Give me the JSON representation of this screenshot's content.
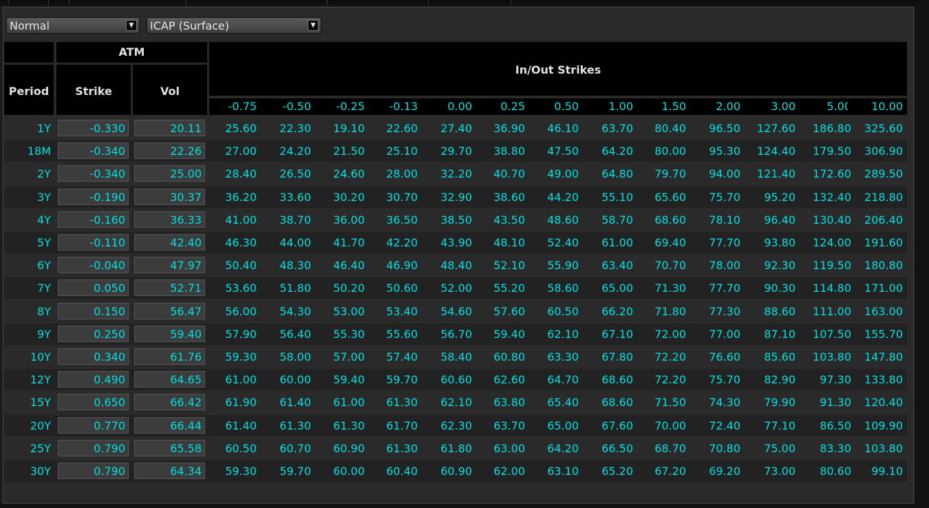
{
  "controls": {
    "mode": "Normal",
    "source": "ICAP (Surface)"
  },
  "headers": {
    "atm": "ATM",
    "period": "Period",
    "strike": "Strike",
    "vol": "Vol",
    "in_out": "In/Out Strikes"
  },
  "strike_columns": [
    "-0.75",
    "-0.50",
    "-0.25",
    "-0.13",
    "0.00",
    "0.25",
    "0.50",
    "1.00",
    "1.50",
    "2.00",
    "3.00",
    "5.00",
    "10.00"
  ],
  "rows": [
    {
      "period": "1Y",
      "strike": "-0.330",
      "vol": "20.11",
      "values": [
        "25.60",
        "22.30",
        "19.10",
        "22.60",
        "27.40",
        "36.90",
        "46.10",
        "63.70",
        "80.40",
        "96.50",
        "127.60",
        "186.80",
        "325.60"
      ]
    },
    {
      "period": "18M",
      "strike": "-0.340",
      "vol": "22.26",
      "values": [
        "27.00",
        "24.20",
        "21.50",
        "25.10",
        "29.70",
        "38.80",
        "47.50",
        "64.20",
        "80.00",
        "95.30",
        "124.40",
        "179.50",
        "306.90"
      ]
    },
    {
      "period": "2Y",
      "strike": "-0.340",
      "vol": "25.00",
      "values": [
        "28.40",
        "26.50",
        "24.60",
        "28.00",
        "32.20",
        "40.70",
        "49.00",
        "64.80",
        "79.70",
        "94.00",
        "121.40",
        "172.60",
        "289.50"
      ]
    },
    {
      "period": "3Y",
      "strike": "-0.190",
      "vol": "30.37",
      "values": [
        "36.20",
        "33.60",
        "30.20",
        "30.70",
        "32.90",
        "38.60",
        "44.20",
        "55.10",
        "65.60",
        "75.70",
        "95.20",
        "132.40",
        "218.80"
      ]
    },
    {
      "period": "4Y",
      "strike": "-0.160",
      "vol": "36.33",
      "values": [
        "41.00",
        "38.70",
        "36.00",
        "36.50",
        "38.50",
        "43.50",
        "48.60",
        "58.70",
        "68.60",
        "78.10",
        "96.40",
        "130.40",
        "206.40"
      ]
    },
    {
      "period": "5Y",
      "strike": "-0.110",
      "vol": "42.40",
      "values": [
        "46.30",
        "44.00",
        "41.70",
        "42.20",
        "43.90",
        "48.10",
        "52.40",
        "61.00",
        "69.40",
        "77.70",
        "93.80",
        "124.00",
        "191.60"
      ]
    },
    {
      "period": "6Y",
      "strike": "-0.040",
      "vol": "47.97",
      "values": [
        "50.40",
        "48.30",
        "46.40",
        "46.90",
        "48.40",
        "52.10",
        "55.90",
        "63.40",
        "70.70",
        "78.00",
        "92.30",
        "119.50",
        "180.80"
      ]
    },
    {
      "period": "7Y",
      "strike": "0.050",
      "vol": "52.71",
      "values": [
        "53.60",
        "51.80",
        "50.20",
        "50.60",
        "52.00",
        "55.20",
        "58.60",
        "65.00",
        "71.30",
        "77.70",
        "90.30",
        "114.80",
        "171.00"
      ]
    },
    {
      "period": "8Y",
      "strike": "0.150",
      "vol": "56.47",
      "values": [
        "56.00",
        "54.30",
        "53.00",
        "53.40",
        "54.60",
        "57.60",
        "60.50",
        "66.20",
        "71.80",
        "77.30",
        "88.60",
        "111.00",
        "163.00"
      ]
    },
    {
      "period": "9Y",
      "strike": "0.250",
      "vol": "59.40",
      "values": [
        "57.90",
        "56.40",
        "55.30",
        "55.60",
        "56.70",
        "59.40",
        "62.10",
        "67.10",
        "72.00",
        "77.00",
        "87.10",
        "107.50",
        "155.70"
      ]
    },
    {
      "period": "10Y",
      "strike": "0.340",
      "vol": "61.76",
      "values": [
        "59.30",
        "58.00",
        "57.00",
        "57.40",
        "58.40",
        "60.80",
        "63.30",
        "67.80",
        "72.20",
        "76.60",
        "85.60",
        "103.80",
        "147.80"
      ]
    },
    {
      "period": "12Y",
      "strike": "0.490",
      "vol": "64.65",
      "values": [
        "61.00",
        "60.00",
        "59.40",
        "59.70",
        "60.60",
        "62.60",
        "64.70",
        "68.60",
        "72.20",
        "75.70",
        "82.90",
        "97.30",
        "133.80"
      ]
    },
    {
      "period": "15Y",
      "strike": "0.650",
      "vol": "66.42",
      "values": [
        "61.90",
        "61.40",
        "61.00",
        "61.30",
        "62.10",
        "63.80",
        "65.40",
        "68.60",
        "71.50",
        "74.30",
        "79.90",
        "91.30",
        "120.40"
      ]
    },
    {
      "period": "20Y",
      "strike": "0.770",
      "vol": "66.44",
      "values": [
        "61.40",
        "61.30",
        "61.30",
        "61.70",
        "62.30",
        "63.70",
        "65.00",
        "67.60",
        "70.00",
        "72.40",
        "77.10",
        "86.50",
        "109.90"
      ]
    },
    {
      "period": "25Y",
      "strike": "0.790",
      "vol": "65.58",
      "values": [
        "60.50",
        "60.70",
        "60.90",
        "61.30",
        "61.80",
        "63.00",
        "64.20",
        "66.50",
        "68.70",
        "70.80",
        "75.00",
        "83.30",
        "103.80"
      ]
    },
    {
      "period": "30Y",
      "strike": "0.790",
      "vol": "64.34",
      "values": [
        "59.30",
        "59.70",
        "60.00",
        "60.40",
        "60.90",
        "62.00",
        "63.10",
        "65.20",
        "67.20",
        "69.20",
        "73.00",
        "80.60",
        "99.10"
      ]
    }
  ]
}
